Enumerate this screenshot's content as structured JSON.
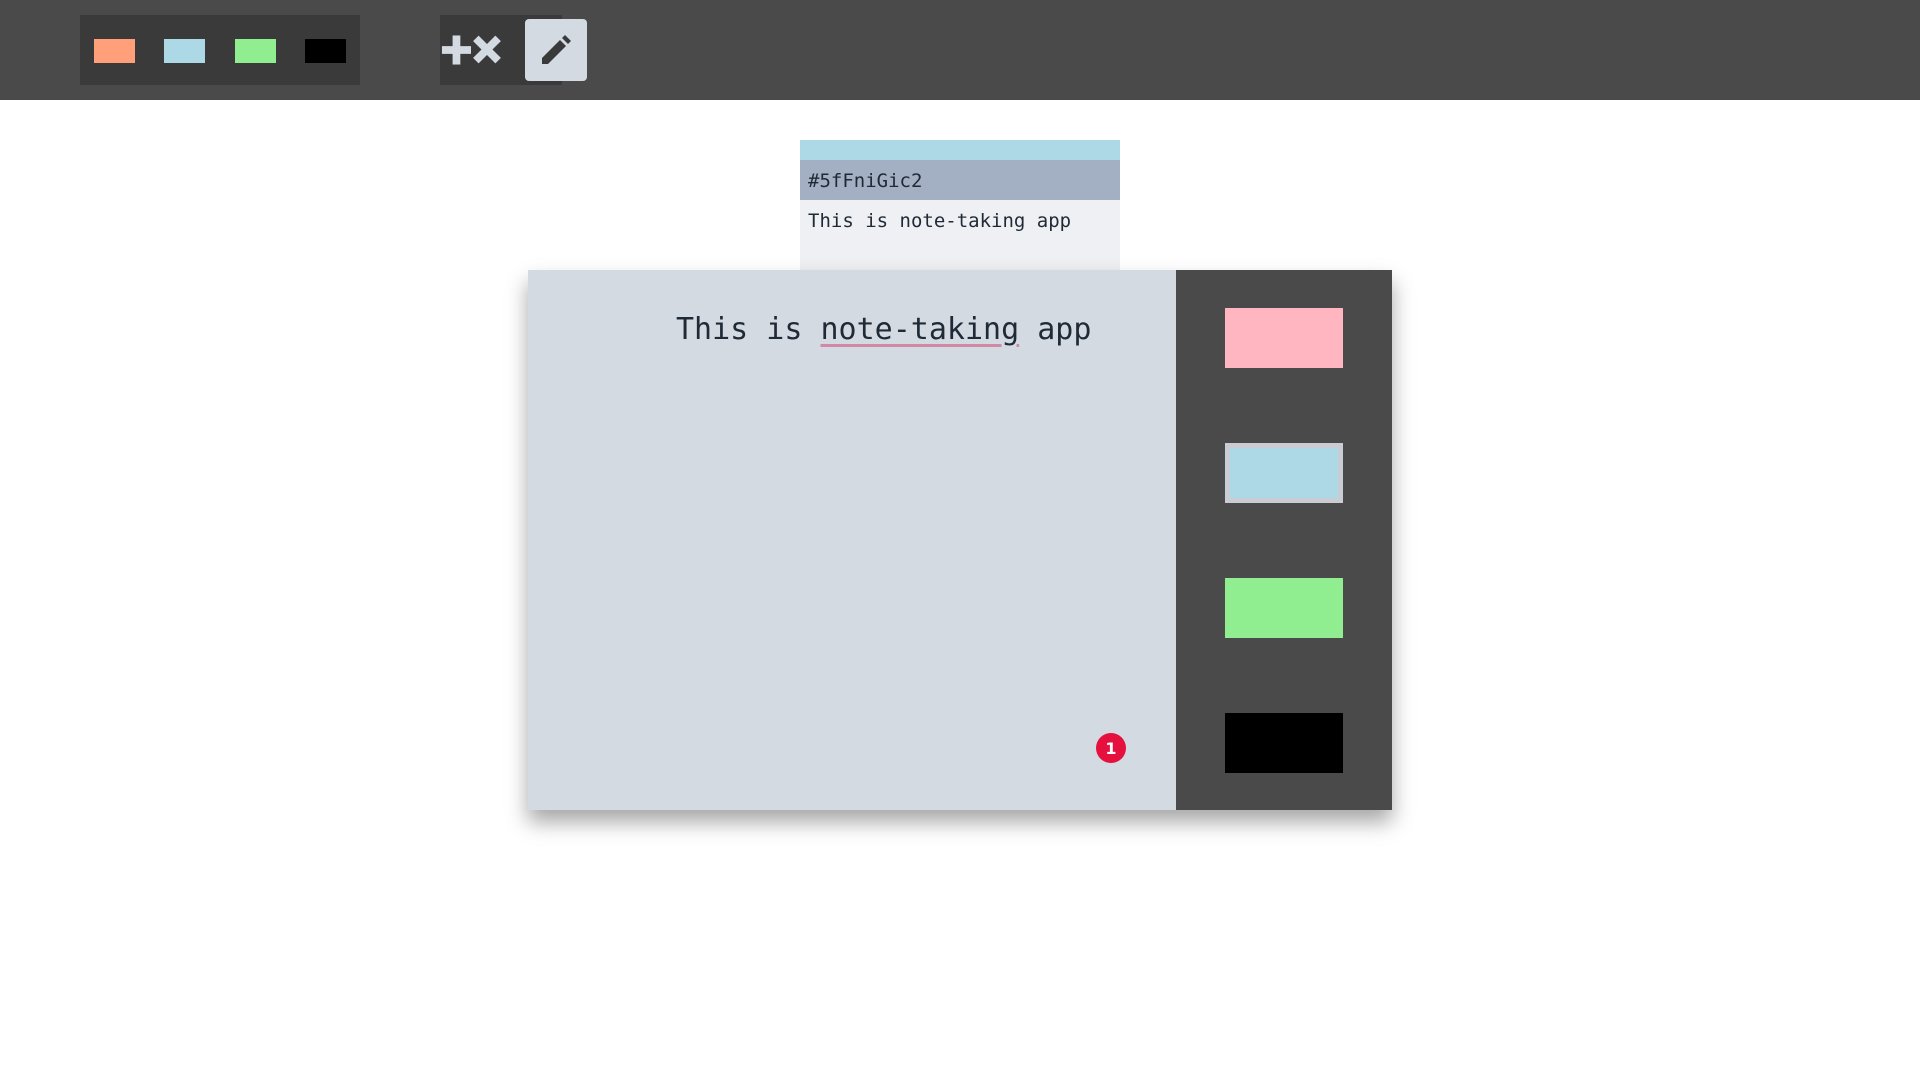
{
  "toolbar": {
    "palette": [
      {
        "name": "orange",
        "color": "#ffa07a"
      },
      {
        "name": "light-blue",
        "color": "#add8e6"
      },
      {
        "name": "light-green",
        "color": "#90ee90"
      },
      {
        "name": "black",
        "color": "#000000"
      }
    ],
    "tools": [
      {
        "name": "add-remove",
        "icon": "plus-times-icon"
      },
      {
        "name": "edit",
        "icon": "pencil-icon",
        "active": true
      }
    ]
  },
  "note_card": {
    "strip_color": "#add8e6",
    "id": "#5fFniGic2",
    "preview": "This is note-taking app"
  },
  "editor": {
    "text_before": "This is ",
    "text_misspelled": "note-taking",
    "text_after": " app",
    "badge_count": "1",
    "body_color": "#d4dae2",
    "colors": [
      {
        "name": "pink",
        "color": "#ffb6c1",
        "selected": false
      },
      {
        "name": "light-blue",
        "color": "#add8e6",
        "selected": true
      },
      {
        "name": "light-green",
        "color": "#90ee90",
        "selected": false
      },
      {
        "name": "black",
        "color": "#000000",
        "selected": false
      }
    ]
  }
}
